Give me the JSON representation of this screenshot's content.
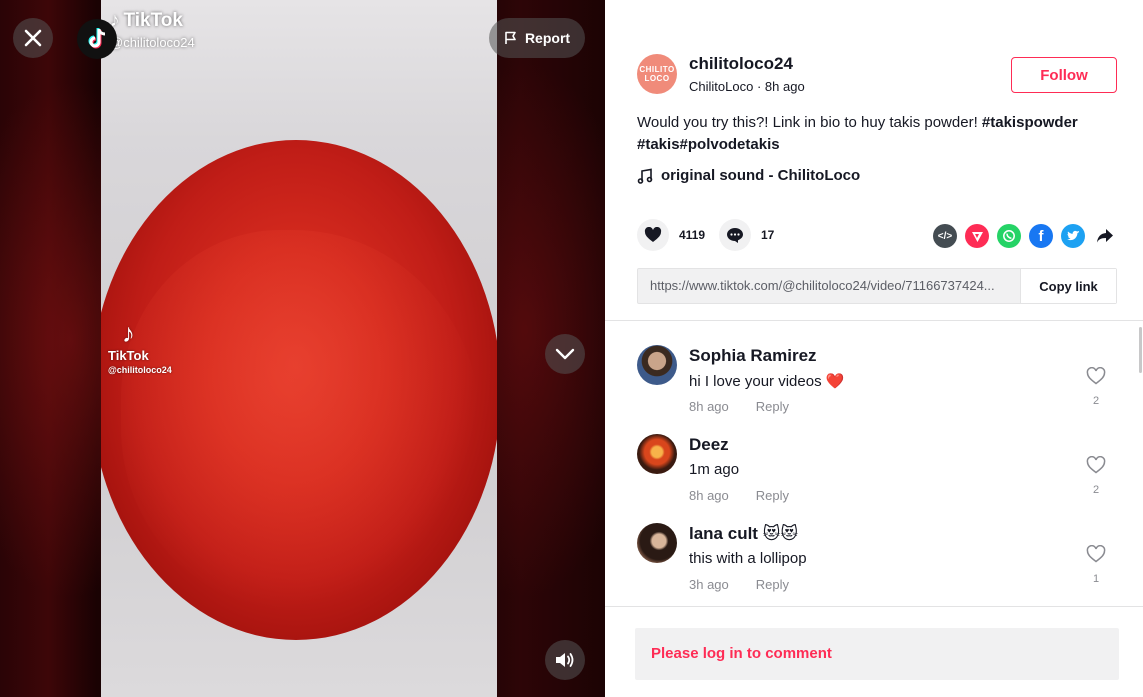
{
  "video": {
    "top_brand": "TikTok",
    "top_handle": "@chilitoloco24",
    "mid_brand": "TikTok",
    "mid_handle": "@chilitoloco24",
    "report_label": "Report"
  },
  "author": {
    "avatar_text_1": "CHILITO",
    "avatar_text_2": "LOCO",
    "username": "chilitoloco24",
    "nickname": "ChilitoLoco",
    "separator": "·",
    "posted": "8h ago",
    "follow_label": "Follow"
  },
  "post": {
    "description": "Would you try this?! Link in bio to huy takis powder!",
    "hashtags": [
      "#takispowder",
      "#takis",
      "#polvodetakis"
    ],
    "sound": "original sound - ChilitoLoco"
  },
  "stats": {
    "likes": "4119",
    "comments": "17"
  },
  "share": {
    "url": "https://www.tiktok.com/@chilitoloco24/video/71166737424...",
    "copy_label": "Copy link"
  },
  "colors": {
    "accent": "#fe2c55",
    "whatsapp": "#25d366",
    "facebook": "#1877f2",
    "twitter": "#1da1f2",
    "embed": "#444c52"
  },
  "comments": [
    {
      "name": "Sophia Ramirez",
      "text": "hi I love your videos ❤️",
      "time": "8h ago",
      "reply": "Reply",
      "likes": "2"
    },
    {
      "name": "Deez",
      "text": "1m ago",
      "time": "8h ago",
      "reply": "Reply",
      "likes": "2"
    },
    {
      "name": "lana cult 😻😻",
      "text": "this with a lollipop",
      "time": "3h ago",
      "reply": "Reply",
      "likes": "1"
    }
  ],
  "login_prompt": "Please log in to comment"
}
